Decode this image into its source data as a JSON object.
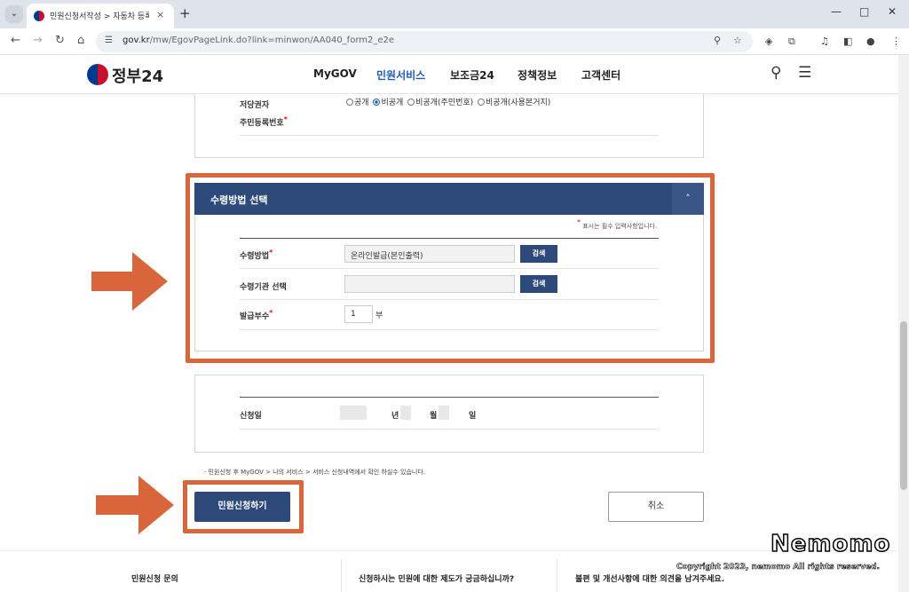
{
  "browser": {
    "tab_title": "민원신청서작성 > 자동차 등록",
    "tab_close": "×",
    "new_tab": "+",
    "url_host": "gov.kr",
    "url_path": "/mw/EgovPageLink.do?link=minwon/AA040_form2_e2e",
    "icons": [
      "back-icon",
      "forward-icon",
      "reload-icon",
      "home-icon",
      "site-info-icon",
      "zoom-icon",
      "bookmark-star-icon",
      "extension-icon",
      "puzzle-icon",
      "media-icon",
      "sidepanel-icon",
      "profile-icon",
      "more-icon"
    ],
    "window_controls": [
      "—",
      "□",
      "✕"
    ]
  },
  "site": {
    "logo_text": "정부24",
    "nav": [
      {
        "label": "MyGOV",
        "active": false
      },
      {
        "label": "민원서비스",
        "active": true
      },
      {
        "label": "보조금24",
        "active": false
      },
      {
        "label": "정책정보",
        "active": false
      },
      {
        "label": "고객센터",
        "active": false
      }
    ]
  },
  "top_section": {
    "label_owner": "저당권자",
    "label_rrn": "주민등록번호",
    "radios": [
      {
        "label": "공개",
        "checked": false
      },
      {
        "label": "비공개",
        "checked": true
      },
      {
        "label": "비공개(주민번호)",
        "checked": false
      },
      {
        "label": "비공개(사용본거지)",
        "checked": false
      }
    ]
  },
  "receipt_section": {
    "title": "수령방법 선택",
    "collapse_icon": "˄",
    "required_note": "표시는 필수 입력사항입니다.",
    "fields": [
      {
        "label": "수령방법",
        "required": true,
        "value": "온라인발급(본인출력)",
        "button": "검색"
      },
      {
        "label": "수령기관 선택",
        "required": false,
        "value": "",
        "button": "검색"
      },
      {
        "label": "발급부수",
        "required": true,
        "value": "1",
        "unit": "부"
      }
    ]
  },
  "date_section": {
    "label": "신청일",
    "year": "년",
    "month": "월",
    "day": "일"
  },
  "notice": "민원신청 후 MyGOV > 나의 서비스 > 서비스 신청내역에서 확인 하실수 있습니다.",
  "buttons": {
    "submit": "민원신청하기",
    "cancel": "취소"
  },
  "footer": {
    "col1": "민원신청 문의",
    "col2": "신청하시는 민원에 대한 제도가 궁금하십니까?",
    "col3": "불편 및 개선사항에 대한 의견을 남겨주세요."
  },
  "watermark": {
    "brand": "Nemomo",
    "copyright": "Copyright 2023, nemomo All rights reserved."
  },
  "colors": {
    "primary": "#2e4a7a",
    "highlight": "#d9663a",
    "required": "#dd1111"
  }
}
